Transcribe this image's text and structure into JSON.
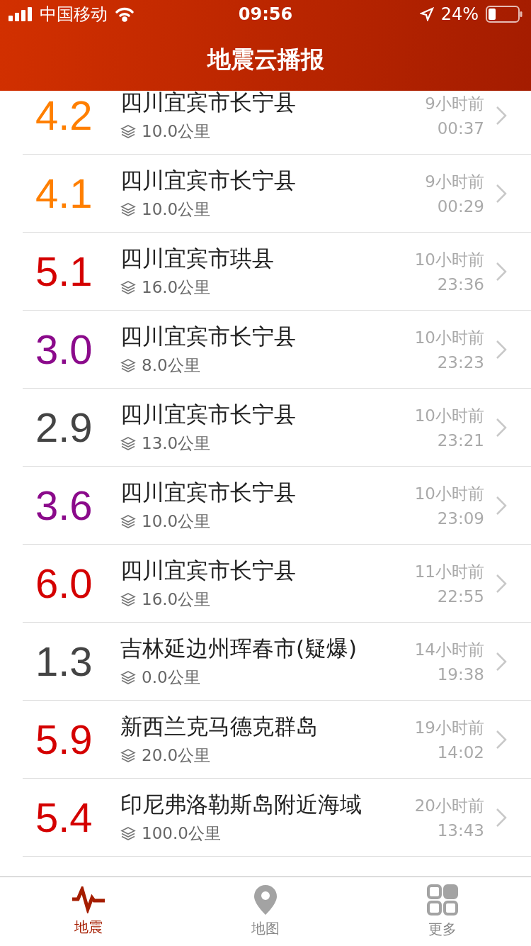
{
  "status_bar": {
    "carrier": "中国移动",
    "time": "09:56",
    "battery": "24%"
  },
  "header": {
    "title": "地震云播报"
  },
  "quakes": [
    {
      "magnitude": "4.2",
      "color": "#ff7f00",
      "place": "四川宜宾市长宁县",
      "depth": "10.0公里",
      "ago": "9小时前",
      "time": "00:37"
    },
    {
      "magnitude": "4.1",
      "color": "#ff7f00",
      "place": "四川宜宾市长宁县",
      "depth": "10.0公里",
      "ago": "9小时前",
      "time": "00:29"
    },
    {
      "magnitude": "5.1",
      "color": "#d40000",
      "place": "四川宜宾市珙县",
      "depth": "16.0公里",
      "ago": "10小时前",
      "time": "23:36"
    },
    {
      "magnitude": "3.0",
      "color": "#8b0a8b",
      "place": "四川宜宾市长宁县",
      "depth": "8.0公里",
      "ago": "10小时前",
      "time": "23:23"
    },
    {
      "magnitude": "2.9",
      "color": "#444444",
      "place": "四川宜宾市长宁县",
      "depth": "13.0公里",
      "ago": "10小时前",
      "time": "23:21"
    },
    {
      "magnitude": "3.6",
      "color": "#8b0a8b",
      "place": "四川宜宾市长宁县",
      "depth": "10.0公里",
      "ago": "10小时前",
      "time": "23:09"
    },
    {
      "magnitude": "6.0",
      "color": "#d40000",
      "place": "四川宜宾市长宁县",
      "depth": "16.0公里",
      "ago": "11小时前",
      "time": "22:55"
    },
    {
      "magnitude": "1.3",
      "color": "#444444",
      "place": "吉林延边州珲春市(疑爆)",
      "depth": "0.0公里",
      "ago": "14小时前",
      "time": "19:38"
    },
    {
      "magnitude": "5.9",
      "color": "#d40000",
      "place": "新西兰克马德克群岛",
      "depth": "20.0公里",
      "ago": "19小时前",
      "time": "14:02"
    },
    {
      "magnitude": "5.4",
      "color": "#d40000",
      "place": "印尼弗洛勒斯岛附近海域",
      "depth": "100.0公里",
      "ago": "20小时前",
      "time": "13:43"
    }
  ],
  "tabs": [
    {
      "label": "地震",
      "kind": "quake",
      "selected": true
    },
    {
      "label": "地图",
      "kind": "map",
      "selected": false
    },
    {
      "label": "更多",
      "kind": "more",
      "selected": false
    }
  ]
}
